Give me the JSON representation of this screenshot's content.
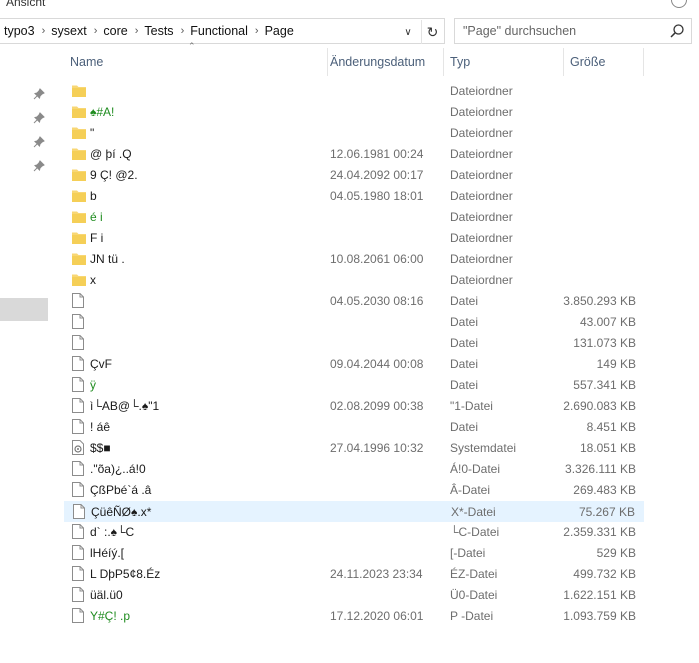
{
  "ribbon": {
    "label": "Ansicht"
  },
  "address": {
    "crumbs": [
      "typo3",
      "sysext",
      "core",
      "Tests",
      "Functional",
      "Page"
    ]
  },
  "search": {
    "placeholder": "\"Page\" durchsuchen"
  },
  "columns": {
    "name": "Name",
    "date": "Änderungsdatum",
    "type": "Typ",
    "size": "Größe"
  },
  "rows": [
    {
      "name": "",
      "date": "",
      "type": "Dateiordner",
      "size": "",
      "kind": "folder",
      "green": true
    },
    {
      "name": "♠#A!",
      "date": "",
      "type": "Dateiordner",
      "size": "",
      "kind": "folder",
      "green": true
    },
    {
      "name": "\"",
      "date": "",
      "type": "Dateiordner",
      "size": "",
      "kind": "folder",
      "green": false
    },
    {
      "name": "@  þí .Q",
      "date": "12.06.1981 00:24",
      "type": "Dateiordner",
      "size": "",
      "kind": "folder",
      "green": false
    },
    {
      "name": "9  Ç! @2.",
      "date": "24.04.2092 00:17",
      "type": "Dateiordner",
      "size": "",
      "kind": "folder",
      "green": false
    },
    {
      "name": "b",
      "date": "04.05.1980 18:01",
      "type": "Dateiordner",
      "size": "",
      "kind": "folder",
      "green": false
    },
    {
      "name": "é i",
      "date": "",
      "type": "Dateiordner",
      "size": "",
      "kind": "folder",
      "green": true
    },
    {
      "name": "F   i",
      "date": "",
      "type": "Dateiordner",
      "size": "",
      "kind": "folder",
      "green": false
    },
    {
      "name": "JN tü .",
      "date": "10.08.2061 06:00",
      "type": "Dateiordner",
      "size": "",
      "kind": "folder",
      "green": false
    },
    {
      "name": "x",
      "date": "",
      "type": "Dateiordner",
      "size": "",
      "kind": "folder",
      "green": false
    },
    {
      "name": "",
      "date": "04.05.2030 08:16",
      "type": "Datei",
      "size": "3.850.293 KB",
      "kind": "file",
      "green": false
    },
    {
      "name": "",
      "date": "",
      "type": "Datei",
      "size": "43.007 KB",
      "kind": "file",
      "green": true
    },
    {
      "name": "",
      "date": "",
      "type": "Datei",
      "size": "131.073 KB",
      "kind": "file",
      "green": false
    },
    {
      "name": " ÇvF",
      "date": "09.04.2044 00:08",
      "type": "Datei",
      "size": "149 KB",
      "kind": "file",
      "green": false
    },
    {
      "name": "   ÿ",
      "date": "",
      "type": "Datei",
      "size": "557.341 KB",
      "kind": "file",
      "green": true
    },
    {
      "name": "ì└AB@└.♠\"1",
      "date": "02.08.2099 00:38",
      "type": "\"1-Datei",
      "size": "2.690.083 KB",
      "kind": "file",
      "green": false
    },
    {
      "name": "  !  áê",
      "date": "",
      "type": "Datei",
      "size": "8.451 KB",
      "kind": "file",
      "green": false
    },
    {
      "name": "$$■",
      "date": "27.04.1996 10:32",
      "type": "Systemdatei",
      "size": "18.051 KB",
      "kind": "sysfile",
      "green": false
    },
    {
      "name": ".\"õa)¿..á!0",
      "date": "",
      "type": "Á!0-Datei",
      "size": "3.326.111 KB",
      "kind": "file",
      "green": false
    },
    {
      "name": "ÇßPbé`á  .â",
      "date": "",
      "type": "Â-Datei",
      "size": "269.483 KB",
      "kind": "file",
      "green": false
    },
    {
      "name": "ÇüêÑØ♠.x*",
      "date": "",
      "type": "X*-Datei",
      "size": "75.267 KB",
      "kind": "file",
      "green": false,
      "selected": true
    },
    {
      "name": "d`  :.♠└C",
      "date": "",
      "type": "└C-Datei",
      "size": "2.359.331 KB",
      "kind": "file",
      "green": false
    },
    {
      "name": "lHéíý.[",
      "date": "",
      "type": "[-Datei",
      "size": "529 KB",
      "kind": "file",
      "green": false
    },
    {
      "name": "L DþP5¢8.Éz",
      "date": "24.11.2023 23:34",
      "type": "ÉZ-Datei",
      "size": "499.732 KB",
      "kind": "file",
      "green": false
    },
    {
      "name": "üäl.ü0",
      "date": "",
      "type": "Ü0-Datei",
      "size": "1.622.151 KB",
      "kind": "file",
      "green": false
    },
    {
      "name": "Y#Ç!   .p",
      "date": "17.12.2020 06:01",
      "type": "P  -Datei",
      "size": "1.093.759 KB",
      "kind": "file",
      "green": true
    }
  ],
  "colors": {
    "folder": "#f8d775",
    "selected_row": "#e5f3ff",
    "header_text": "#4c607a",
    "green_text": "#1f8c1f"
  }
}
